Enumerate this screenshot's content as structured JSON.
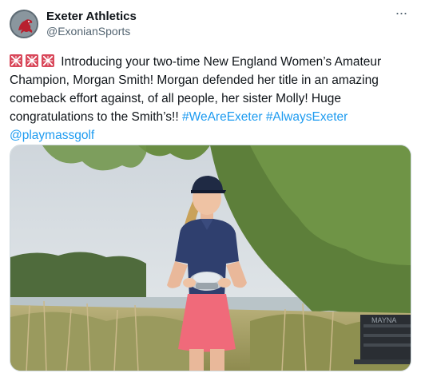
{
  "author": {
    "display_name": "Exeter Athletics",
    "handle": "@ExonianSports",
    "avatar_icon": "exeter-lion-logo"
  },
  "more_icon": "more-options-icon",
  "tweet": {
    "emoji": [
      "exeter-flag-emoji",
      "exeter-flag-emoji",
      "exeter-flag-emoji"
    ],
    "text": " Introducing your two-time New England Women’s Amateur Champion, Morgan Smith! Morgan defended her title in an amazing comeback effort against, of all people, her sister Molly! Huge congratulations to the Smith’s!! ",
    "hashtag_1": "#WeAreExeter",
    "hashtag_2": "#AlwaysExeter",
    "mention": "@playmassgolf"
  },
  "media": {
    "bench_text": "MAYNA"
  },
  "colors": {
    "link": "#1d9bf0",
    "skirt": "#f06a7a",
    "polo": "#2f3f6e",
    "accent_red": "#d94a5c"
  }
}
